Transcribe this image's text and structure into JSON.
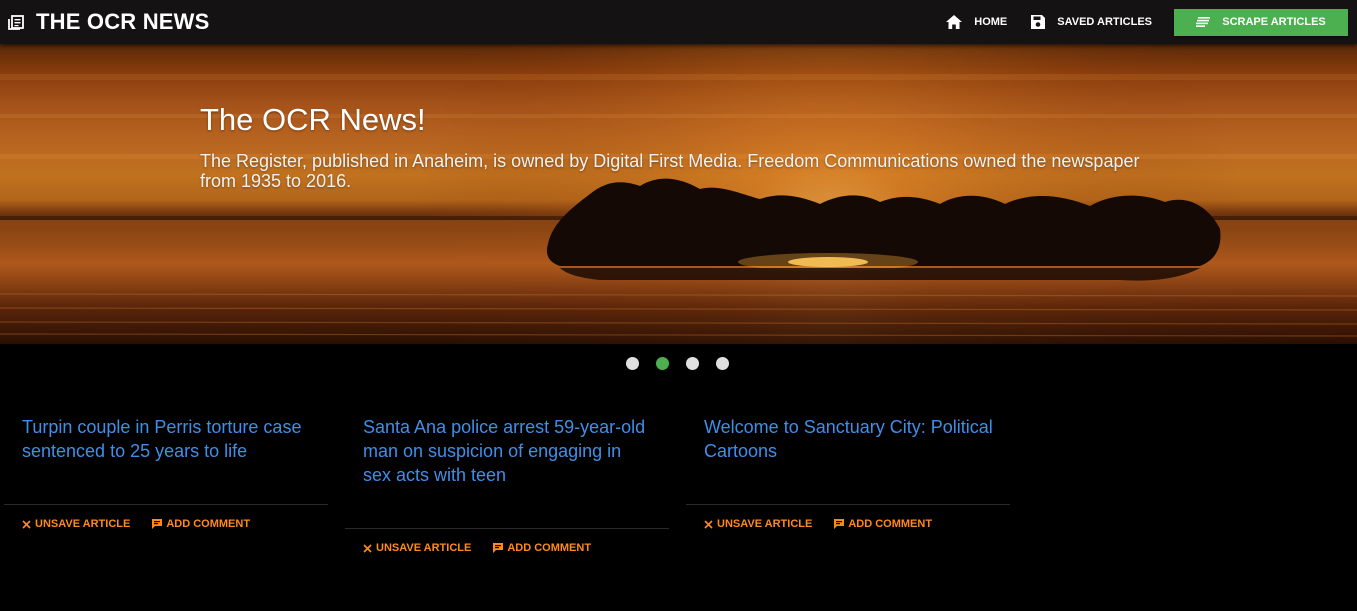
{
  "navbar": {
    "brand_icon": "newspaper-icon",
    "title": "THE OCR NEWS",
    "links": [
      {
        "icon": "home-icon",
        "label": "HOME"
      },
      {
        "icon": "save-icon",
        "label": "SAVED ARTICLES"
      }
    ],
    "scrape_button": {
      "icon": "list-icon",
      "label": "SCRAPE ARTICLES",
      "color": "#4caf50"
    }
  },
  "hero": {
    "title": "The OCR News!",
    "description": "The Register, published in Anaheim, is owned by Digital First Media. Freedom Communications owned the newspaper from 1935 to 2016."
  },
  "carousel": {
    "slide_count": 4,
    "active_index": 1,
    "active_color": "#4caf50"
  },
  "articles": [
    {
      "headline": "Turpin couple in Perris torture case sentenced to 25 years to life",
      "unsave_label": "UNSAVE ARTICLE",
      "comment_label": "ADD COMMENT"
    },
    {
      "headline": "Santa Ana police arrest 59-year-old man on suspicion of engaging in sex acts with teen",
      "unsave_label": "UNSAVE ARTICLE",
      "comment_label": "ADD COMMENT"
    },
    {
      "headline": "Welcome to Sanctuary City: Political Cartoons",
      "unsave_label": "UNSAVE ARTICLE",
      "comment_label": "ADD COMMENT"
    }
  ],
  "colors": {
    "link": "#3f8fe8",
    "action": "#ff8a1c",
    "navbar": "#141213"
  }
}
